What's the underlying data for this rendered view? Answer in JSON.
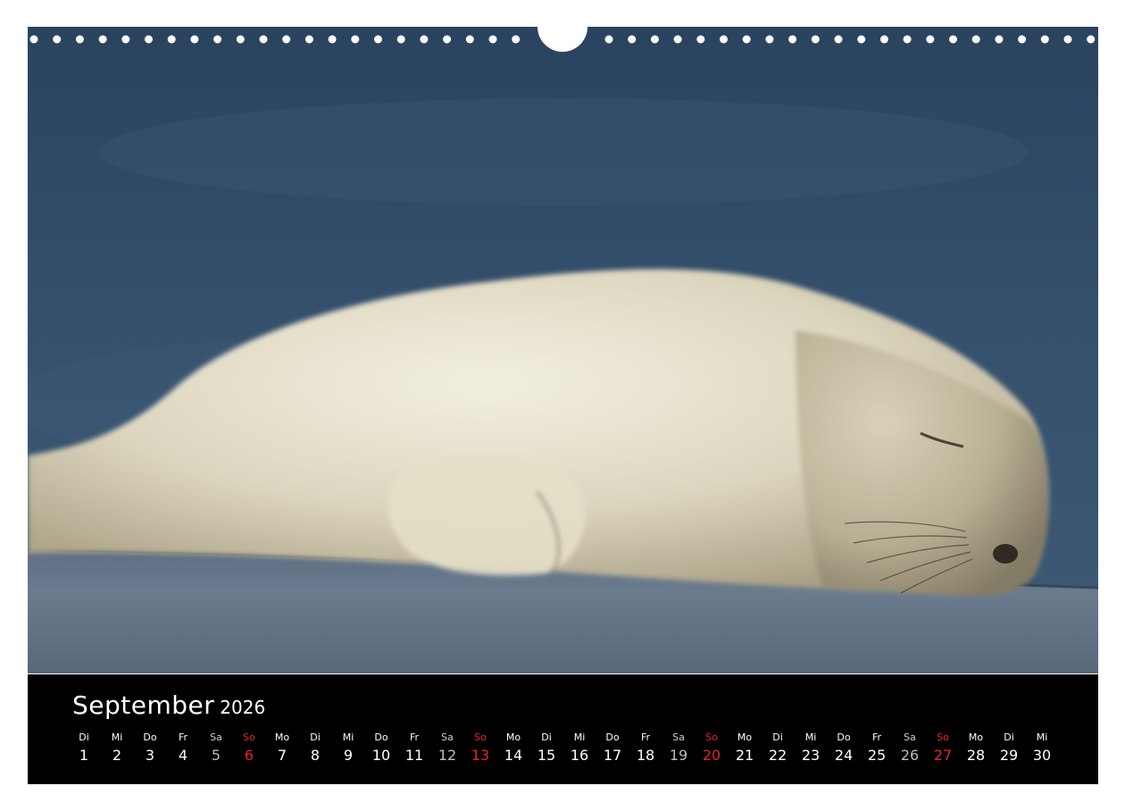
{
  "month": "September",
  "year": "2026",
  "colors": {
    "sunday": "#e8222b",
    "saturday": "#bdbdbd",
    "weekday": "#ffffff",
    "bar_background": "#000000"
  },
  "days": [
    {
      "wd": "Di",
      "num": "1",
      "type": "weekday"
    },
    {
      "wd": "Mi",
      "num": "2",
      "type": "weekday"
    },
    {
      "wd": "Do",
      "num": "3",
      "type": "weekday"
    },
    {
      "wd": "Fr",
      "num": "4",
      "type": "weekday"
    },
    {
      "wd": "Sa",
      "num": "5",
      "type": "saturday"
    },
    {
      "wd": "So",
      "num": "6",
      "type": "sunday"
    },
    {
      "wd": "Mo",
      "num": "7",
      "type": "weekday"
    },
    {
      "wd": "Di",
      "num": "8",
      "type": "weekday"
    },
    {
      "wd": "Mi",
      "num": "9",
      "type": "weekday"
    },
    {
      "wd": "Do",
      "num": "10",
      "type": "weekday"
    },
    {
      "wd": "Fr",
      "num": "11",
      "type": "weekday"
    },
    {
      "wd": "Sa",
      "num": "12",
      "type": "saturday"
    },
    {
      "wd": "So",
      "num": "13",
      "type": "sunday"
    },
    {
      "wd": "Mo",
      "num": "14",
      "type": "weekday"
    },
    {
      "wd": "Di",
      "num": "15",
      "type": "weekday"
    },
    {
      "wd": "Mi",
      "num": "16",
      "type": "weekday"
    },
    {
      "wd": "Do",
      "num": "17",
      "type": "weekday"
    },
    {
      "wd": "Fr",
      "num": "18",
      "type": "weekday"
    },
    {
      "wd": "Sa",
      "num": "19",
      "type": "saturday"
    },
    {
      "wd": "So",
      "num": "20",
      "type": "sunday"
    },
    {
      "wd": "Mo",
      "num": "21",
      "type": "weekday"
    },
    {
      "wd": "Di",
      "num": "22",
      "type": "weekday"
    },
    {
      "wd": "Mi",
      "num": "23",
      "type": "weekday"
    },
    {
      "wd": "Do",
      "num": "24",
      "type": "weekday"
    },
    {
      "wd": "Fr",
      "num": "25",
      "type": "weekday"
    },
    {
      "wd": "Sa",
      "num": "26",
      "type": "saturday"
    },
    {
      "wd": "So",
      "num": "27",
      "type": "sunday"
    },
    {
      "wd": "Mo",
      "num": "28",
      "type": "weekday"
    },
    {
      "wd": "Di",
      "num": "29",
      "type": "weekday"
    },
    {
      "wd": "Mi",
      "num": "30",
      "type": "weekday"
    }
  ]
}
